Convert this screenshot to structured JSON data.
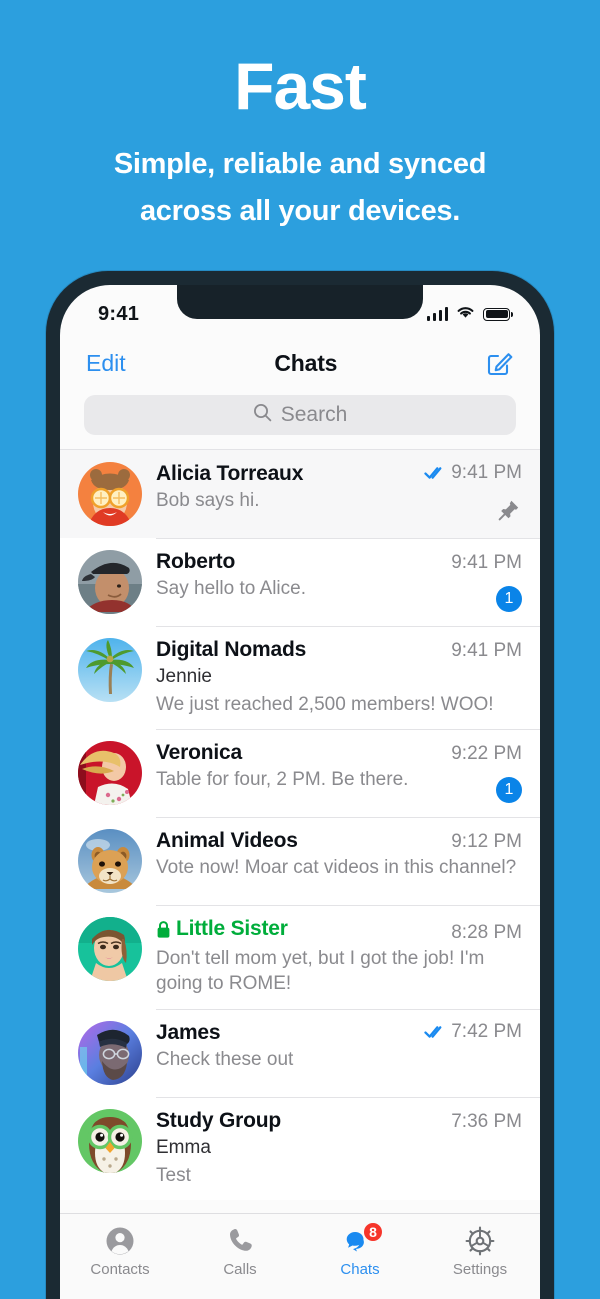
{
  "hero": {
    "title": "Fast",
    "subtitle_line1": "Simple, reliable and synced",
    "subtitle_line2": "across all your devices."
  },
  "colors": {
    "background": "#2c9fde",
    "accent_blue": "#2c8fef",
    "badge_blue": "#0a84e8",
    "badge_red": "#f6352b",
    "secret_green": "#00ad3b",
    "phone_frame": "#1b2a33"
  },
  "phone": {
    "statusbar": {
      "time": "9:41",
      "signal_icon": "cellular-signal-icon",
      "wifi_icon": "wifi-icon",
      "battery_icon": "battery-full-icon"
    },
    "navbar": {
      "left_button": "Edit",
      "title": "Chats",
      "compose_icon": "compose-icon"
    },
    "search": {
      "placeholder": "Search",
      "icon": "search-icon"
    },
    "chats": [
      {
        "name": "Alicia Torreaux",
        "sender": "",
        "snippet": "Bob says hi.",
        "time": "9:41 PM",
        "read_receipt": true,
        "badge": "",
        "pinned": true,
        "secret": false,
        "avatar": "girl-with-orange-slices-avatar"
      },
      {
        "name": "Roberto",
        "sender": "",
        "snippet": "Say hello to Alice.",
        "time": "9:41 PM",
        "read_receipt": false,
        "badge": "1",
        "pinned": false,
        "secret": false,
        "avatar": "man-in-cap-avatar"
      },
      {
        "name": "Digital Nomads",
        "sender": "Jennie",
        "snippet": "We just reached 2,500 members! WOO!",
        "time": "9:41 PM",
        "read_receipt": false,
        "badge": "",
        "pinned": false,
        "secret": false,
        "avatar": "palm-tree-avatar"
      },
      {
        "name": "Veronica",
        "sender": "",
        "snippet": "Table for four, 2 PM. Be there.",
        "time": "9:22 PM",
        "read_receipt": false,
        "badge": "1",
        "pinned": false,
        "secret": false,
        "avatar": "blonde-woman-red-background-avatar"
      },
      {
        "name": "Animal Videos",
        "sender": "",
        "snippet": "Vote now! Moar cat videos in this channel?",
        "time": "9:12 PM",
        "read_receipt": false,
        "badge": "",
        "pinned": false,
        "secret": false,
        "avatar": "lion-cub-avatar"
      },
      {
        "name": "Little Sister",
        "sender": "",
        "snippet": "Don't tell mom yet, but I got the job! I'm going to ROME!",
        "time": "8:28 PM",
        "read_receipt": false,
        "badge": "",
        "pinned": false,
        "secret": true,
        "avatar": "woman-teal-background-avatar"
      },
      {
        "name": "James",
        "sender": "",
        "snippet": "Check these out",
        "time": "7:42 PM",
        "read_receipt": true,
        "badge": "",
        "pinned": false,
        "secret": false,
        "avatar": "bearded-man-beanie-avatar"
      },
      {
        "name": "Study Group",
        "sender": "Emma",
        "snippet": "Test",
        "time": "7:36 PM",
        "read_receipt": false,
        "badge": "",
        "pinned": false,
        "secret": false,
        "avatar": "owl-avatar"
      }
    ],
    "tabs": [
      {
        "label": "Contacts",
        "icon": "contacts-icon",
        "active": false,
        "badge": ""
      },
      {
        "label": "Calls",
        "icon": "phone-icon",
        "active": false,
        "badge": ""
      },
      {
        "label": "Chats",
        "icon": "chat-bubbles-icon",
        "active": true,
        "badge": "8"
      },
      {
        "label": "Settings",
        "icon": "gear-icon",
        "active": false,
        "badge": ""
      }
    ]
  }
}
